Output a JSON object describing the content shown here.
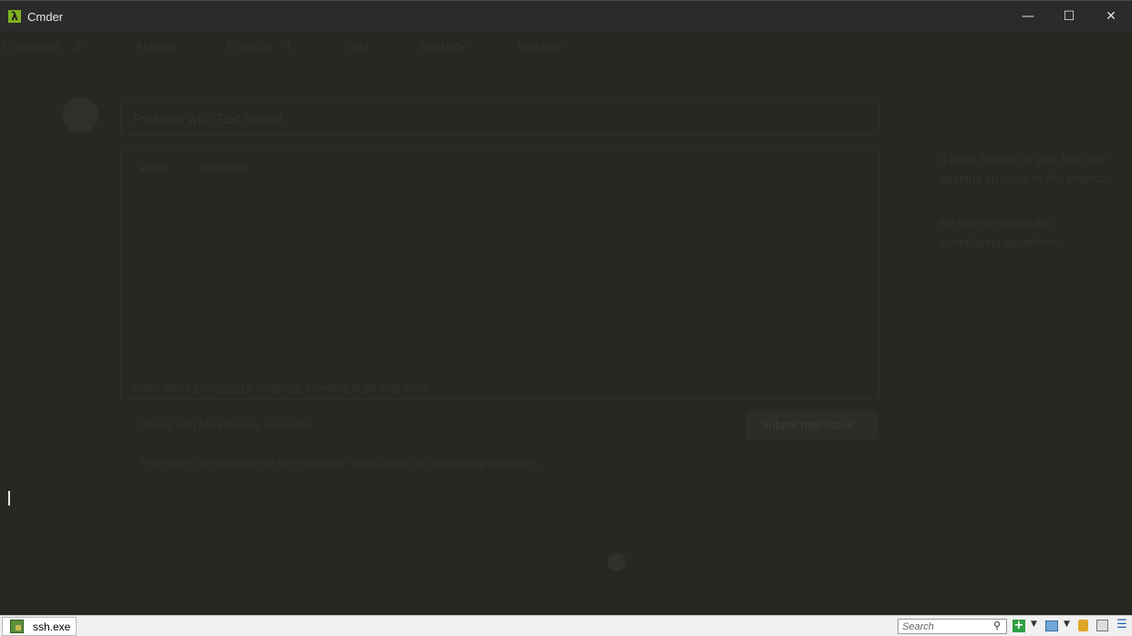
{
  "window": {
    "title": "Cmder",
    "logo_glyph": "λ",
    "minimize_glyph": "—",
    "maximize_glyph": "☐",
    "close_glyph": "✕"
  },
  "console": {
    "background": "#272822",
    "cursor": "|"
  },
  "ghost": {
    "nav": [
      "ll requests",
      "2",
      "Actions",
      "Projects",
      "1",
      "Wiki",
      "Security",
      "Insights"
    ],
    "issue_title": "Problem with Text based",
    "tabs": [
      "Write",
      "Preview"
    ],
    "sidebar_text_1": "It looks like this is your first time opening an issue in this project!",
    "sidebar_text_2": "Be sure to review the contributing guidelines.",
    "attach_hint": "Attach files by dragging & dropping, selecting or pasting them.",
    "markdown_hint": "Styling with Markdown is supported",
    "submit_label": "Submit new issue",
    "guidelines_note": "Remember, contributions to this repository should follow its contributing guidelines."
  },
  "statusbar": {
    "tab_label": "ssh.exe",
    "search_placeholder": "Search",
    "search_icon": "⚲",
    "new_console_icon": "+",
    "dropdown_icon": "▼",
    "menu_icon": "☰"
  }
}
